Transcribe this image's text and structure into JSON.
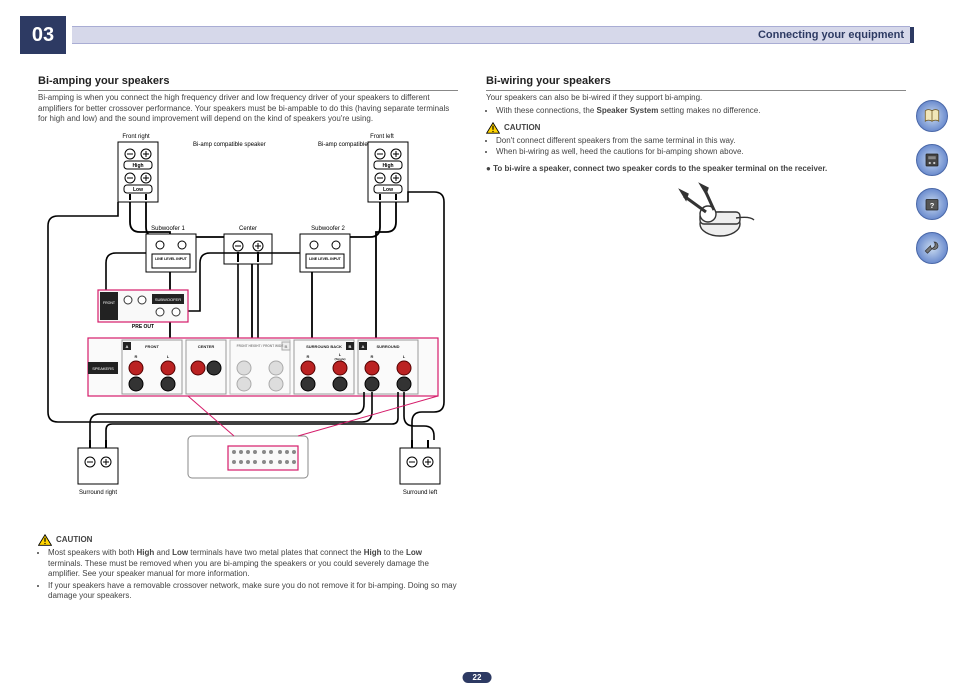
{
  "chapter": "03",
  "header_title": "Connecting your equipment",
  "page_number": "22",
  "left": {
    "title": "Bi-amping your speakers",
    "intro": "Bi-amping is when you connect the high frequency driver and low frequency driver of your speakers to different amplifiers for better crossover performance. Your speakers must be bi-ampable to do this (having separate terminals for high and low) and the sound improvement will depend on the kind of speakers you're using.",
    "labels": {
      "front_right": "Front right",
      "front_left": "Front left",
      "biamp_compat": "Bi-amp compatible speaker",
      "subwoofer1": "Subwoofer 1",
      "subwoofer2": "Subwoofer 2",
      "center": "Center",
      "line_level": "LINE LEVEL INPUT",
      "preout": "PRE OUT",
      "speakers": "SPEAKERS",
      "front": "FRONT",
      "center_term": "CENTER",
      "front_height": "FRONT HEIGHT / FRONT WIDE",
      "surround_back": "SURROUND BACK",
      "surround": "SURROUND",
      "surround_right": "Surround right",
      "surround_left": "Surround left",
      "high": "High",
      "low": "Low",
      "a": "A",
      "b": "B",
      "r": "R",
      "l": "L",
      "single": "(Single)",
      "subwoofer_term": "SUBWOOFER"
    },
    "caution_label": "CAUTION",
    "caution1_a": "Most speakers with both ",
    "caution1_b": " and ",
    "caution1_c": " terminals have two metal plates that connect the ",
    "caution1_d": " to the ",
    "caution1_e": " terminals. These must be removed when you are bi-amping the speakers or you could severely damage the amplifier. See your speaker manual for more information.",
    "caution2": "If your speakers have a removable crossover network, make sure you do not remove it for bi-amping. Doing so may damage your speakers."
  },
  "right": {
    "title": "Bi-wiring your speakers",
    "intro": "Your speakers can also be bi-wired if they support bi-amping.",
    "bullet_a": "With these connections, the ",
    "bullet_b": "Speaker System",
    "bullet_c": " setting makes no difference.",
    "caution_label": "CAUTION",
    "caution1": "Don't connect different speakers from the same terminal in this way.",
    "caution2": "When bi-wiring as well, heed the cautions for bi-amping shown above.",
    "step": "To bi-wire a speaker, connect two speaker cords to the speaker terminal on the receiver."
  },
  "icons": {
    "book": "book-icon",
    "device": "device-icon",
    "help": "help-icon",
    "wrench": "wrench-icon"
  }
}
